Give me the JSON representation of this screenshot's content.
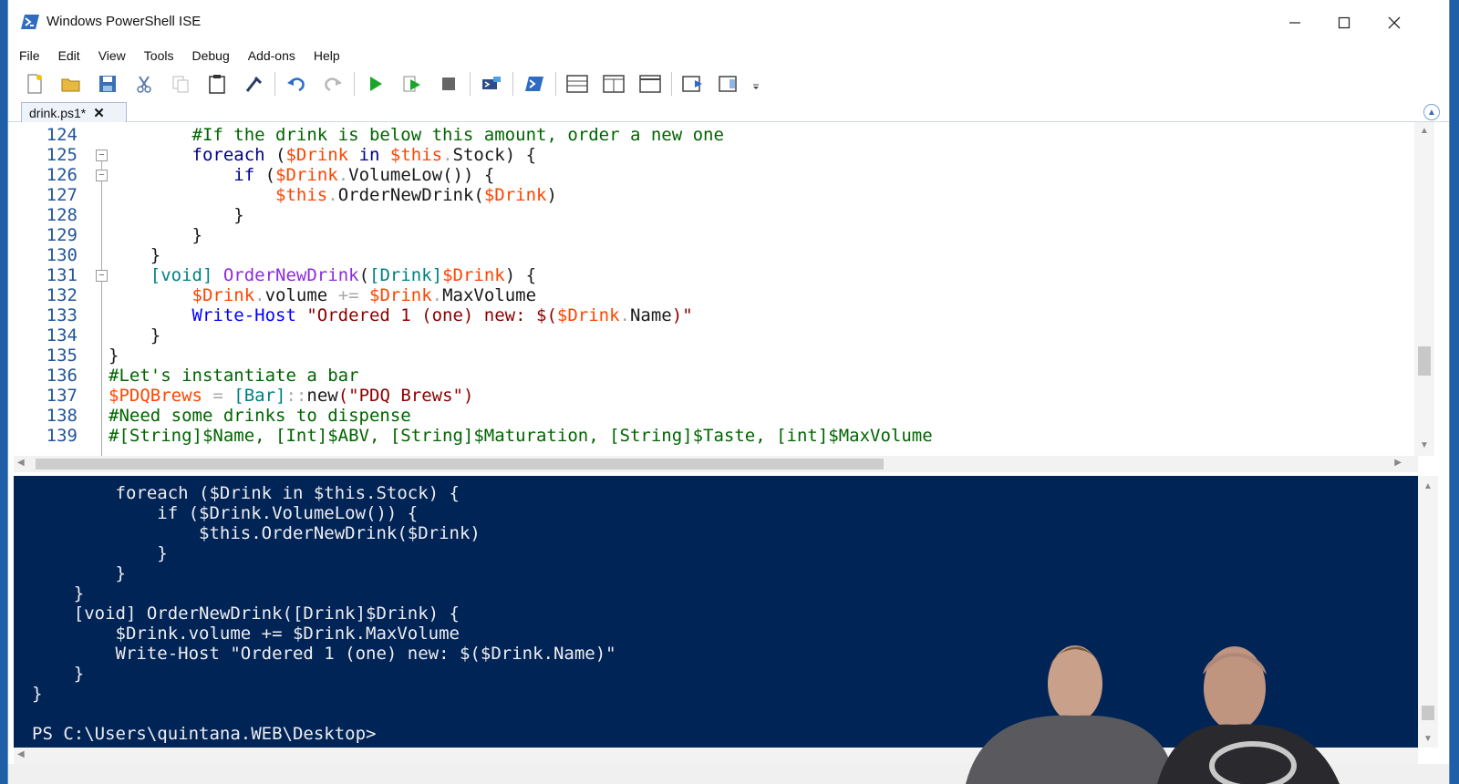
{
  "window": {
    "title": "Windows PowerShell ISE",
    "minimize": "—",
    "maximize": "☐",
    "close": "✕"
  },
  "menu": [
    "File",
    "Edit",
    "View",
    "Tools",
    "Debug",
    "Add-ons",
    "Help"
  ],
  "toolbar": [
    "new-icon",
    "open-icon",
    "save-icon",
    "cut-icon",
    "copy-icon",
    "paste-icon",
    "clear-icon",
    "undo-icon",
    "redo-icon",
    "run-icon",
    "run-selection-icon",
    "stop-icon",
    "remote-icon",
    "powershell-icon",
    "layout-top-icon",
    "layout-right-icon",
    "layout-max-icon",
    "show-script-icon",
    "show-console-icon",
    "overflow-icon"
  ],
  "tab": {
    "label": "drink.ps1*",
    "close": "✕"
  },
  "editor": {
    "line_numbers": [
      "124",
      "125",
      "126",
      "127",
      "128",
      "129",
      "130",
      "131",
      "132",
      "133",
      "134",
      "135",
      "136",
      "137",
      "138",
      "139"
    ],
    "lines": [
      [
        {
          "t": "        ",
          "c": "pl"
        },
        {
          "t": "#If the drink is below this amount, order a new one",
          "c": "cm"
        }
      ],
      [
        {
          "t": "        ",
          "c": "pl"
        },
        {
          "t": "foreach",
          "c": "kw"
        },
        {
          "t": " (",
          "c": "pl"
        },
        {
          "t": "$Drink",
          "c": "vr"
        },
        {
          "t": " in ",
          "c": "kw"
        },
        {
          "t": "$this",
          "c": "vr"
        },
        {
          "t": ".",
          "c": "op"
        },
        {
          "t": "Stock",
          "c": "mb"
        },
        {
          "t": ") {",
          "c": "pl"
        }
      ],
      [
        {
          "t": "            ",
          "c": "pl"
        },
        {
          "t": "if",
          "c": "kw"
        },
        {
          "t": " (",
          "c": "pl"
        },
        {
          "t": "$Drink",
          "c": "vr"
        },
        {
          "t": ".",
          "c": "op"
        },
        {
          "t": "VolumeLow",
          "c": "mb"
        },
        {
          "t": "()) {",
          "c": "pl"
        }
      ],
      [
        {
          "t": "                ",
          "c": "pl"
        },
        {
          "t": "$this",
          "c": "vr"
        },
        {
          "t": ".",
          "c": "op"
        },
        {
          "t": "OrderNewDrink",
          "c": "mb"
        },
        {
          "t": "(",
          "c": "pl"
        },
        {
          "t": "$Drink",
          "c": "vr"
        },
        {
          "t": ")",
          "c": "pl"
        }
      ],
      [
        {
          "t": "            }",
          "c": "pl"
        }
      ],
      [
        {
          "t": "        }",
          "c": "pl"
        }
      ],
      [
        {
          "t": "    }",
          "c": "pl"
        }
      ],
      [
        {
          "t": "    ",
          "c": "pl"
        },
        {
          "t": "[void]",
          "c": "ty"
        },
        {
          "t": " ",
          "c": "pl"
        },
        {
          "t": "OrderNewDrink",
          "c": "fn"
        },
        {
          "t": "(",
          "c": "pl"
        },
        {
          "t": "[Drink]",
          "c": "ty"
        },
        {
          "t": "$Drink",
          "c": "vr"
        },
        {
          "t": ") {",
          "c": "pl"
        }
      ],
      [
        {
          "t": "        ",
          "c": "pl"
        },
        {
          "t": "$Drink",
          "c": "vr"
        },
        {
          "t": ".",
          "c": "op"
        },
        {
          "t": "volume",
          "c": "mb"
        },
        {
          "t": " += ",
          "c": "op"
        },
        {
          "t": "$Drink",
          "c": "vr"
        },
        {
          "t": ".",
          "c": "op"
        },
        {
          "t": "MaxVolume",
          "c": "mb"
        }
      ],
      [
        {
          "t": "        ",
          "c": "pl"
        },
        {
          "t": "Write-Host",
          "c": "cmd"
        },
        {
          "t": " \"Ordered 1 (one) new: $(",
          "c": "st"
        },
        {
          "t": "$Drink",
          "c": "vr"
        },
        {
          "t": ".",
          "c": "op"
        },
        {
          "t": "Name",
          "c": "mb"
        },
        {
          "t": ")\"",
          "c": "st"
        }
      ],
      [
        {
          "t": "    }",
          "c": "pl"
        }
      ],
      [
        {
          "t": "}",
          "c": "pl"
        }
      ],
      [
        {
          "t": "#Let's instantiate a bar",
          "c": "cm"
        }
      ],
      [
        {
          "t": "$PDQBrews",
          "c": "vr"
        },
        {
          "t": " = ",
          "c": "op"
        },
        {
          "t": "[Bar]",
          "c": "ty"
        },
        {
          "t": "::",
          "c": "op"
        },
        {
          "t": "new",
          "c": "mb"
        },
        {
          "t": "(\"PDQ Brews\")",
          "c": "st"
        }
      ],
      [
        {
          "t": "#Need some drinks to dispense",
          "c": "cm"
        }
      ],
      [
        {
          "t": "#[String]$Name, [Int]$ABV, [String]$Maturation, [String]$Taste, [int]$MaxVolume",
          "c": "cm"
        }
      ]
    ]
  },
  "console": {
    "lines": [
      "        foreach ($Drink in $this.Stock) {",
      "            if ($Drink.VolumeLow()) {",
      "                $this.OrderNewDrink($Drink)",
      "            }",
      "        }",
      "    }",
      "    [void] OrderNewDrink([Drink]$Drink) {",
      "        $Drink.volume += $Drink.MaxVolume",
      "        Write-Host \"Ordered 1 (one) new: $($Drink.Name)\"",
      "    }",
      "}"
    ],
    "prompt": "PS C:\\Users\\quintana.WEB\\Desktop>"
  },
  "colors": {
    "console_bg": "#012456",
    "accent": "#1f5fa8"
  }
}
